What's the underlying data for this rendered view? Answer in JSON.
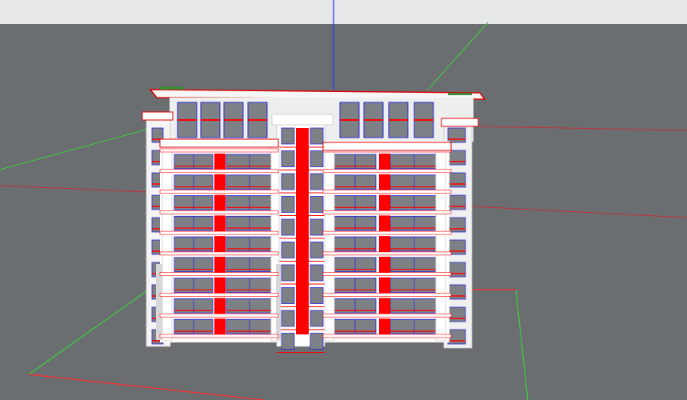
{
  "app": {
    "viewport_kind": "3d-model-viewport"
  },
  "scene": {
    "object": "residential-building-model",
    "storeys": 9,
    "colors": {
      "sky": "#e6e8e9",
      "ground": "#6a6e71",
      "wall": "#ffffff",
      "wall_shade": "#d7d7da",
      "glass": "#7d8186",
      "accent": "#ff0000",
      "mullion": "#2a2ad8",
      "axis_red": "#ff2020",
      "axis_green": "#20d020",
      "axis_blue": "#2020ff",
      "roof_green": "#3a8a3a"
    },
    "axes": [
      "red-axis",
      "green-axis",
      "blue-axis"
    ]
  }
}
